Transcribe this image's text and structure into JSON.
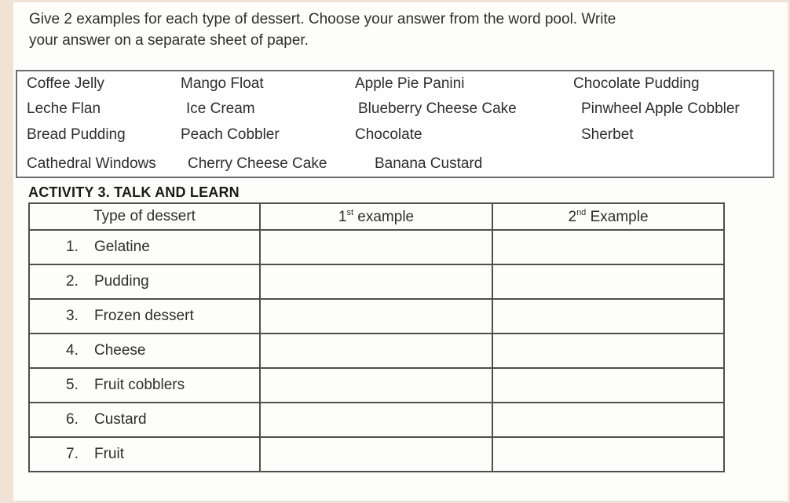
{
  "instructions": {
    "line1": "Give 2 examples for each type of dessert. Choose your answer from the word pool. Write",
    "line2": "your answer on a separate sheet of paper."
  },
  "word_pool": {
    "rows": [
      [
        "Coffee Jelly",
        "Mango Float",
        "Apple Pie Panini",
        "Chocolate Pudding"
      ],
      [
        "Leche Flan",
        "Ice Cream",
        "Blueberry Cheese Cake",
        "Pinwheel Apple Cobbler"
      ],
      [
        "Bread Pudding",
        "Peach Cobbler",
        "Chocolate",
        "Sherbet"
      ],
      [
        "Cathedral Windows",
        "Cherry Cheese Cake",
        "Banana Custard"
      ]
    ]
  },
  "activity": {
    "title": "ACTIVITY 3. TALK AND LEARN"
  },
  "table": {
    "headers": {
      "type": "Type of dessert",
      "first_num": "1",
      "first_sup": "st",
      "first_text": " example",
      "second_num": "2",
      "second_sup": "nd",
      "second_text": " Example"
    },
    "rows": [
      {
        "num": "1.",
        "type": "Gelatine",
        "first": "",
        "second": ""
      },
      {
        "num": "2.",
        "type": "Pudding",
        "first": "",
        "second": ""
      },
      {
        "num": "3.",
        "type": "Frozen dessert",
        "first": "",
        "second": ""
      },
      {
        "num": "4.",
        "type": "Cheese",
        "first": "",
        "second": ""
      },
      {
        "num": "5.",
        "type": "Fruit cobblers",
        "first": "",
        "second": ""
      },
      {
        "num": "6.",
        "type": "Custard",
        "first": "",
        "second": ""
      },
      {
        "num": "7.",
        "type": "Fruit",
        "first": "",
        "second": ""
      }
    ]
  },
  "colors": {
    "background": "#f1e2d6",
    "sheet": "#fdfdfc",
    "border": "#4f4f4f",
    "text": "#2e2e2e"
  }
}
